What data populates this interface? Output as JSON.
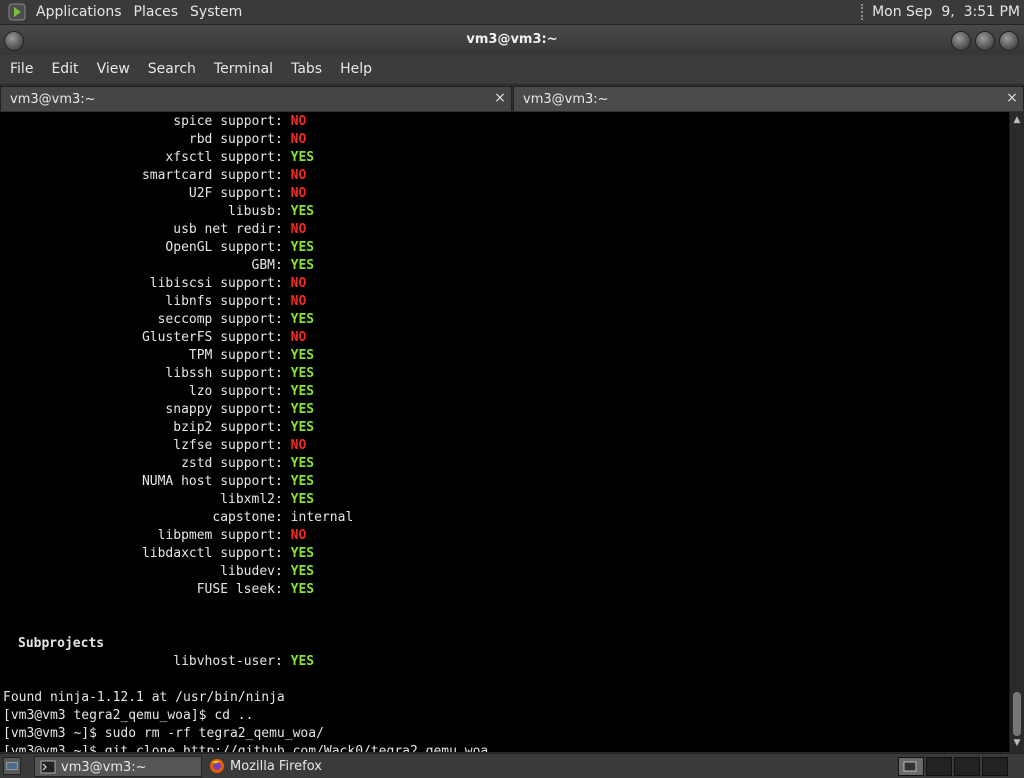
{
  "top_panel": {
    "menus": [
      "Applications",
      "Places",
      "System"
    ],
    "clock": "Mon Sep  9,  3:51 PM"
  },
  "window": {
    "title": "vm3@vm3:~"
  },
  "menubar": [
    "File",
    "Edit",
    "View",
    "Search",
    "Terminal",
    "Tabs",
    "Help"
  ],
  "tabs": [
    {
      "label": "vm3@vm3:~",
      "close": "×",
      "active": true
    },
    {
      "label": "vm3@vm3:~",
      "close": "×",
      "active": false
    }
  ],
  "terminal": {
    "features": [
      {
        "label": "spice support",
        "value": "NO",
        "status": "no"
      },
      {
        "label": "rbd support",
        "value": "NO",
        "status": "no"
      },
      {
        "label": "xfsctl support",
        "value": "YES",
        "status": "yes"
      },
      {
        "label": "smartcard support",
        "value": "NO",
        "status": "no"
      },
      {
        "label": "U2F support",
        "value": "NO",
        "status": "no"
      },
      {
        "label": "libusb",
        "value": "YES",
        "status": "yes"
      },
      {
        "label": "usb net redir",
        "value": "NO",
        "status": "no"
      },
      {
        "label": "OpenGL support",
        "value": "YES",
        "status": "yes"
      },
      {
        "label": "GBM",
        "value": "YES",
        "status": "yes"
      },
      {
        "label": "libiscsi support",
        "value": "NO",
        "status": "no"
      },
      {
        "label": "libnfs support",
        "value": "NO",
        "status": "no"
      },
      {
        "label": "seccomp support",
        "value": "YES",
        "status": "yes"
      },
      {
        "label": "GlusterFS support",
        "value": "NO",
        "status": "no"
      },
      {
        "label": "TPM support",
        "value": "YES",
        "status": "yes"
      },
      {
        "label": "libssh support",
        "value": "YES",
        "status": "yes"
      },
      {
        "label": "lzo support",
        "value": "YES",
        "status": "yes"
      },
      {
        "label": "snappy support",
        "value": "YES",
        "status": "yes"
      },
      {
        "label": "bzip2 support",
        "value": "YES",
        "status": "yes"
      },
      {
        "label": "lzfse support",
        "value": "NO",
        "status": "no"
      },
      {
        "label": "zstd support",
        "value": "YES",
        "status": "yes"
      },
      {
        "label": "NUMA host support",
        "value": "YES",
        "status": "yes"
      },
      {
        "label": "libxml2",
        "value": "YES",
        "status": "yes"
      },
      {
        "label": "capstone",
        "value": "internal",
        "status": "plain"
      },
      {
        "label": "libpmem support",
        "value": "NO",
        "status": "no"
      },
      {
        "label": "libdaxctl support",
        "value": "YES",
        "status": "yes"
      },
      {
        "label": "libudev",
        "value": "YES",
        "status": "yes"
      },
      {
        "label": "FUSE lseek",
        "value": "YES",
        "status": "yes"
      }
    ],
    "subprojects_heading": "Subprojects",
    "subprojects": [
      {
        "label": "libvhost-user",
        "value": "YES",
        "status": "yes"
      }
    ],
    "output_lines": [
      "Found ninja-1.12.1 at /usr/bin/ninja",
      "[vm3@vm3 tegra2_qemu_woa]$ cd ..",
      "[vm3@vm3 ~]$ sudo rm -rf tegra2_qemu_woa/",
      "[vm3@vm3 ~]$ git clone http://github.com/Wack0/tegra2_qemu_woa"
    ]
  },
  "taskbar": {
    "tasks": [
      {
        "label": "vm3@vm3:~",
        "icon": "terminal-icon",
        "active": true
      },
      {
        "label": "Mozilla Firefox",
        "icon": "firefox-icon",
        "active": false
      }
    ]
  },
  "colors": {
    "yes": "#8ae234",
    "no": "#ef2929",
    "terminal_bg": "#000000",
    "panel_bg": "#3a3a3a"
  }
}
